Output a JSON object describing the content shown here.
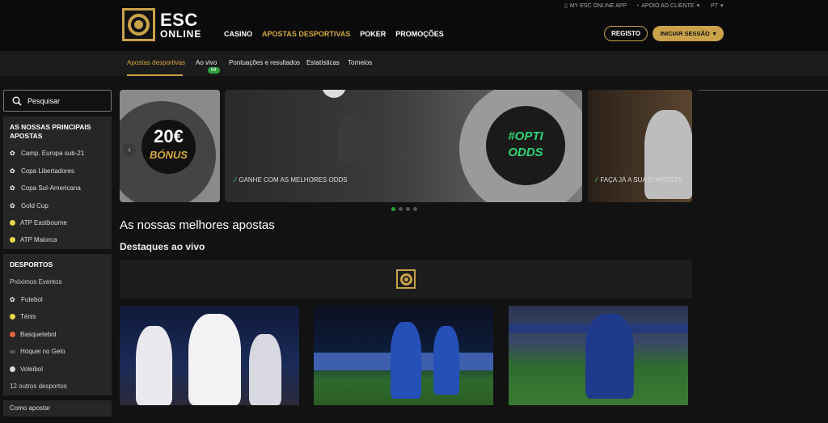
{
  "brand": {
    "line1": "ESC",
    "line2": "ONLINE"
  },
  "main_nav": [
    "CASINO",
    "APOSTAS DESPORTIVAS",
    "POKER",
    "PROMOÇÕES"
  ],
  "utility": {
    "app": "MY ESC ONLINE APP",
    "support": "APOIO AO CLIENTE",
    "lang": "PT"
  },
  "buttons": {
    "register": "REGISTO",
    "login": "INICIAR SESSÃO"
  },
  "sub_nav": {
    "items": [
      "Apostas desportivas",
      "Ao vivo",
      "Pontuações e resultados",
      "Estatísticas",
      "Torneios"
    ],
    "live_count": "64"
  },
  "search": {
    "placeholder": "Pesquisar"
  },
  "top_bets": {
    "title": "AS NOSSAS PRINCIPAIS APOSTAS",
    "items": [
      {
        "label": "Camp. Europa sub-21",
        "icon": "football-icon"
      },
      {
        "label": "Copa Libertadores",
        "icon": "football-icon"
      },
      {
        "label": "Copa Sul-Americana",
        "icon": "football-icon"
      },
      {
        "label": "Gold Cup",
        "icon": "football-icon"
      },
      {
        "label": "ATP Eastbourne",
        "icon": "tennis-ball-icon"
      },
      {
        "label": "ATP Maiorca",
        "icon": "tennis-ball-icon"
      }
    ]
  },
  "sports": {
    "title": "DESPORTOS",
    "upcoming": "Próximos Eventos",
    "items": [
      {
        "label": "Futebol",
        "icon": "football-icon"
      },
      {
        "label": "Ténis",
        "icon": "tennis-ball-icon"
      },
      {
        "label": "Basquetebol",
        "icon": "basketball-icon"
      },
      {
        "label": "Hóquei no Gelo",
        "icon": "hockey-puck-icon"
      },
      {
        "label": "Voleibol",
        "icon": "volleyball-icon"
      }
    ],
    "more": "12 outros desportos"
  },
  "how_to_bet": "Como apostar",
  "carousel": {
    "slide1": {
      "line1": "20€",
      "line2": "BÓNUS"
    },
    "slide2": {
      "promo_line1": "#OPTI",
      "promo_line2": "ODDS",
      "caption": "GANHE COM AS MELHORES ODDS"
    },
    "slide3": {
      "caption": "FAÇA JÁ A SUA 1ª APOSTA"
    }
  },
  "headings": {
    "best_bets": "As nossas melhores apostas",
    "live_highlights": "Destaques ao vivo"
  },
  "colors": {
    "gold": "#c9a24a",
    "green": "#2e9e3e",
    "background": "#121212"
  }
}
